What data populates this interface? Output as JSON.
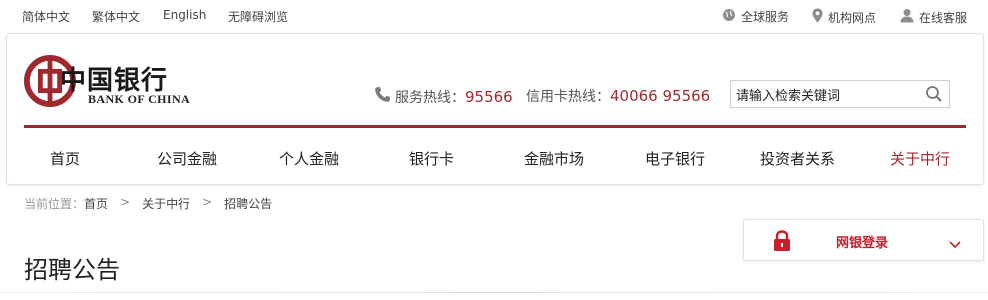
{
  "topbar": {
    "languages": [
      "简体中文",
      "繁体中文",
      "English",
      "无障碍浏览"
    ],
    "utilities": [
      {
        "label": "全球服务",
        "icon": "globe-icon"
      },
      {
        "label": "机构网点",
        "icon": "location-pin-icon"
      },
      {
        "label": "在线客服",
        "icon": "user-support-icon"
      }
    ]
  },
  "brand": {
    "name_cn": "中国银行",
    "name_en": "BANK OF CHINA",
    "color": "#a0292f"
  },
  "hotlines": {
    "service_label": "服务热线：",
    "service_number": "95566",
    "card_label": "信用卡热线：",
    "card_number": "40066 95566"
  },
  "search": {
    "value": "请输入检索关键词"
  },
  "nav": {
    "items": [
      "首页",
      "公司金融",
      "个人金融",
      "银行卡",
      "金融市场",
      "电子银行",
      "投资者关系",
      "关于中行"
    ],
    "active_index": 7
  },
  "breadcrumb": {
    "prefix": "当前位置：",
    "items": [
      "首页",
      "关于中行",
      "招聘公告"
    ],
    "separator": ">"
  },
  "page": {
    "title": "招聘公告"
  },
  "ebank_login": {
    "label": "网银登录",
    "accent": "#c8202b"
  }
}
